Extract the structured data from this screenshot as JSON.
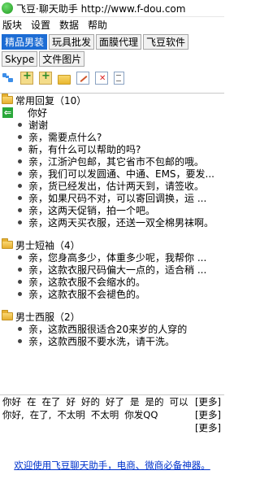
{
  "window": {
    "title": "飞豆·聊天助手 http://www.f-dou.com"
  },
  "menu": [
    "版块",
    "设置",
    "数据",
    "帮助"
  ],
  "tabs": [
    {
      "label": "精品男装",
      "active": true
    },
    {
      "label": "玩具批发",
      "active": false
    },
    {
      "label": "面膜代理",
      "active": false
    },
    {
      "label": "飞豆软件",
      "active": false
    },
    {
      "label": "Skype",
      "active": false
    },
    {
      "label": "文件图片",
      "active": false
    }
  ],
  "toolbar_icons": [
    "tree-icon",
    "add-item-icon",
    "add-group-icon",
    "folder-icon",
    "edit-icon",
    "delete-icon",
    "document-icon"
  ],
  "groups": [
    {
      "label": "常用回复（10）",
      "items": [
        "你好",
        "谢谢",
        "亲，需要点什么?",
        "新，有什么可以帮助的吗?",
        "亲，江浙沪包邮，其它省市不包邮的哦。",
        "亲，我们可以发圆通、中通、EMS，要发...",
        "亲，货已经发出，估计两天到，请签收。",
        "亲，如果尺码不对，可以寄回调换，运 ...",
        "亲，这两天促销，拍一个吧。",
        "亲，这两天买衣服，还送一双全棉男袜啊。"
      ]
    },
    {
      "label": "男士短袖（4）",
      "items": [
        "亲，您身高多少，体重多少呢，我帮你 ...",
        "亲，这款衣服尺码偏大一点的，适合稍 ...",
        "亲，这款衣服不会缩水的。",
        "亲，这款衣服不会褪色的。"
      ]
    },
    {
      "label": "男士西服（2）",
      "items": [
        "亲，这款西服很适合20来岁的人穿的",
        "亲，这款西服不要水洗，请干洗。"
      ]
    }
  ],
  "quick_rows": [
    {
      "words": [
        "你好",
        "在",
        "在了",
        "好",
        "好的",
        "好了",
        "是",
        "是的",
        "可以"
      ],
      "more": "[更多]"
    },
    {
      "words": [
        "你好,",
        "在了,",
        "不太明",
        "不太明",
        "你发QQ"
      ],
      "more": "[更多]"
    },
    {
      "words": [],
      "more": "[更多]"
    }
  ],
  "footer": {
    "link": "欢迎使用飞豆聊天助手，电商、微商必备神器。"
  }
}
